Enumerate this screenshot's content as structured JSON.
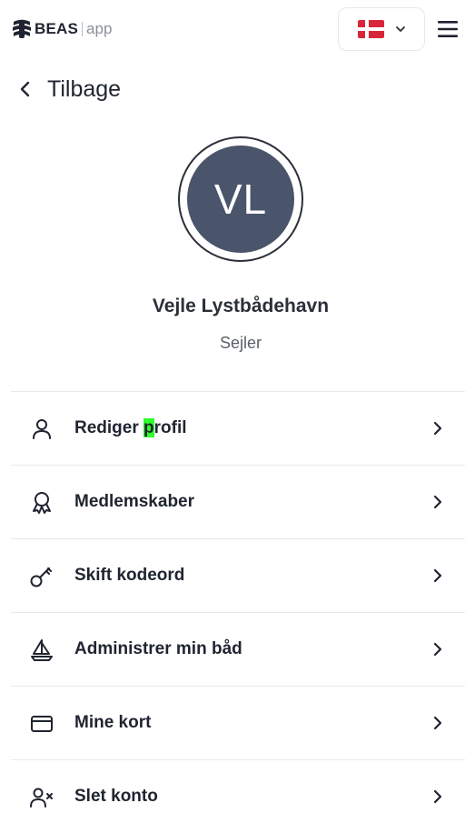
{
  "header": {
    "brand": "BEAS",
    "brand_suffix": "app",
    "language_flag": "denmark-flag-icon",
    "colors": {
      "flag_red": "#d9253a",
      "flag_white": "#ffffff"
    }
  },
  "back": {
    "label": "Tilbage"
  },
  "profile": {
    "initials": "VL",
    "name": "Vejle Lystbådehavn",
    "role": "Sejler",
    "avatar_color": "#4a556b"
  },
  "menu": {
    "items": [
      {
        "label_pre": "Rediger ",
        "label_hl": "p",
        "label_post": "rofil",
        "icon": "user-icon"
      },
      {
        "label": "Medlemskaber",
        "icon": "award-ribbon-icon"
      },
      {
        "label": "Skift kodeord",
        "icon": "key-icon"
      },
      {
        "label": "Administrer min båd",
        "icon": "sailboat-icon"
      },
      {
        "label": "Mine kort",
        "icon": "credit-card-icon"
      },
      {
        "label": "Slet konto",
        "icon": "user-remove-icon"
      }
    ]
  }
}
